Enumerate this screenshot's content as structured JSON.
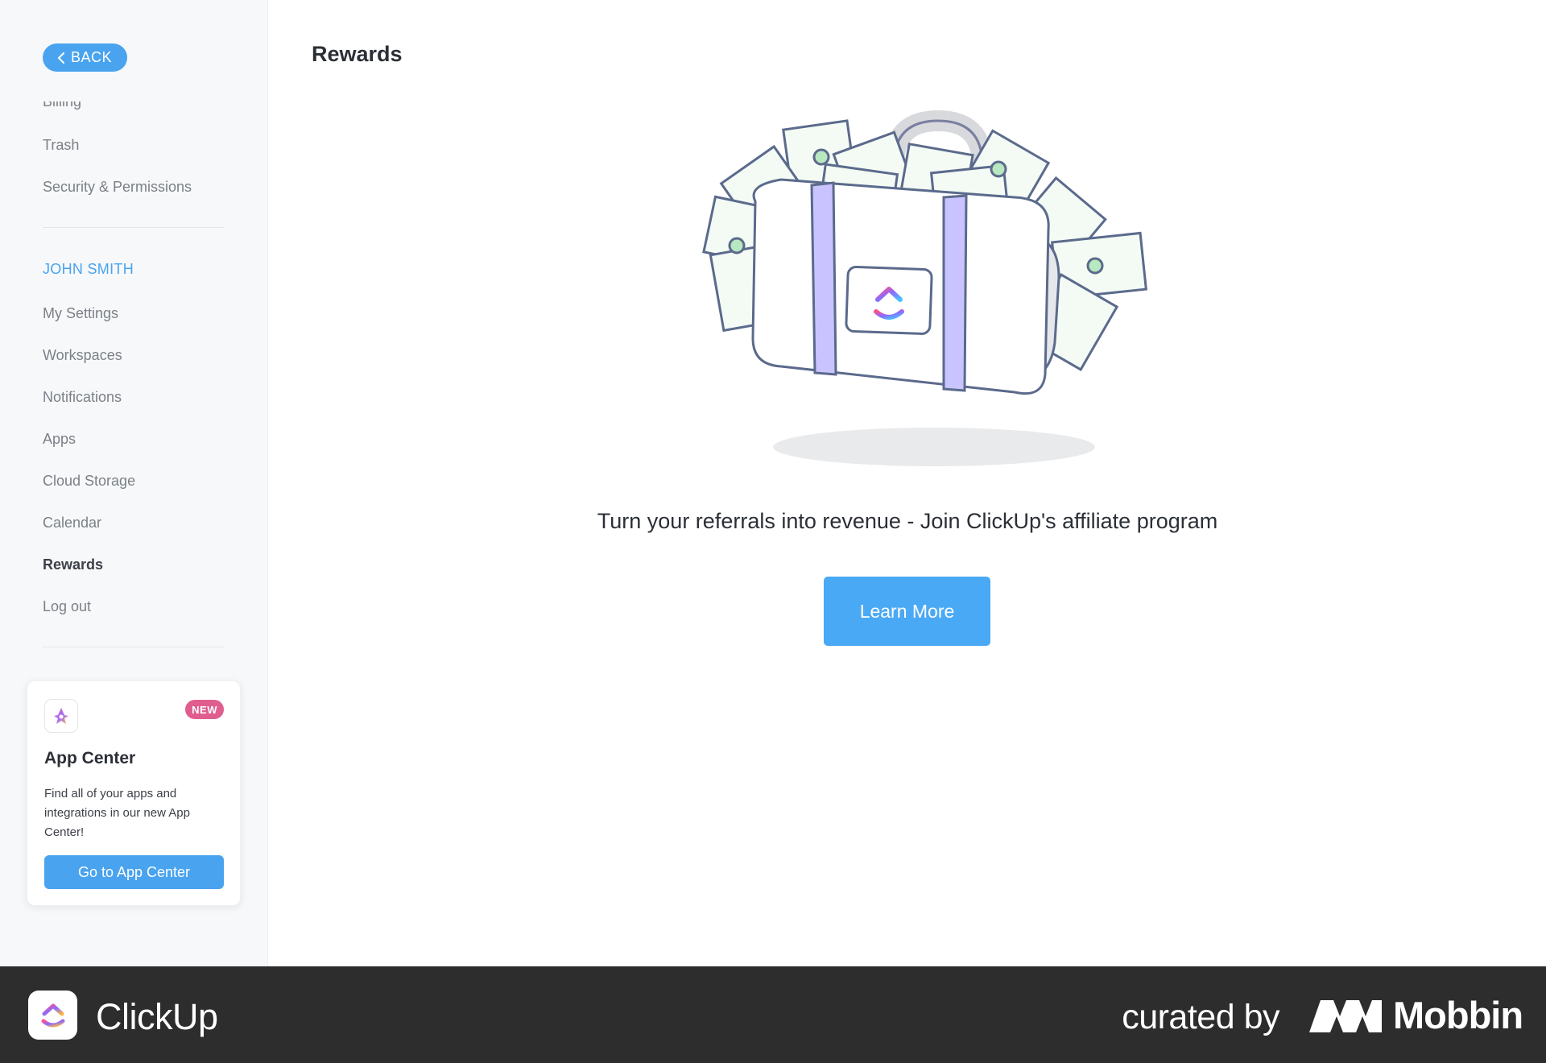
{
  "sidebar": {
    "back_label": "BACK",
    "items_top": [
      "Billing",
      "Trash",
      "Security & Permissions"
    ],
    "user_section_title": "JOHN SMITH",
    "items": [
      "My Settings",
      "Workspaces",
      "Notifications",
      "Apps",
      "Cloud Storage",
      "Calendar",
      "Rewards",
      "Log out"
    ],
    "active_item": "Rewards",
    "app_card": {
      "badge": "NEW",
      "title": "App Center",
      "description": "Find all of your apps and integrations in our new App Center!",
      "button_label": "Go to App Center"
    }
  },
  "main": {
    "title": "Rewards",
    "headline": "Turn your referrals into revenue - Join ClickUp's affiliate program",
    "learn_more_label": "Learn More"
  },
  "footer": {
    "brand": "ClickUp",
    "curated_by": "curated by",
    "curator": "Mobbin"
  },
  "colors": {
    "accent": "#49a3ef",
    "badge": "#e05d8f",
    "footer_bg": "#2d2d2e"
  }
}
